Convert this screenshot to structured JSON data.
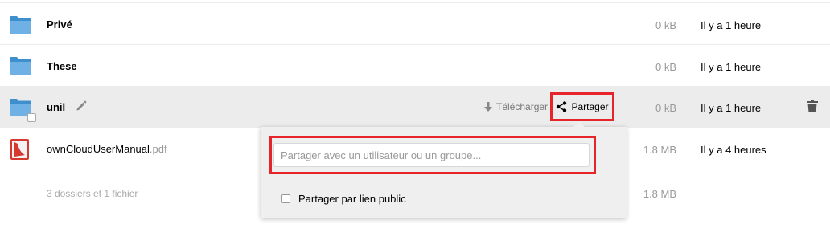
{
  "files": [
    {
      "name": "Privé",
      "ext": "",
      "size": "0 kB",
      "modified": "Il y a 1 heure",
      "type": "folder"
    },
    {
      "name": "These",
      "ext": "",
      "size": "0 kB",
      "modified": "Il y a 1 heure",
      "type": "folder"
    },
    {
      "name": "unil",
      "ext": "",
      "size": "0 kB",
      "modified": "Il y a 1 heure",
      "type": "folder"
    },
    {
      "name": "ownCloudUserManual",
      "ext": ".pdf",
      "size": "1.8 MB",
      "modified": "Il y a 4 heures",
      "type": "pdf"
    }
  ],
  "actions": {
    "download_label": "Télécharger",
    "share_label": "Partager"
  },
  "share_dropdown": {
    "input_placeholder": "Partager avec un utilisateur ou un groupe...",
    "public_link_label": "Partager par lien public",
    "public_link_checked": false
  },
  "summary": {
    "text": "3 dossiers et 1 fichier",
    "total_size": "1.8 MB"
  },
  "colors": {
    "folder_blue": "#4a9ad6",
    "highlight_red": "#e8242b",
    "selected_row": "#ececec",
    "pdf_red": "#d63a2f"
  },
  "icons": [
    "folder-icon",
    "pdf-icon",
    "pencil-icon",
    "download-icon",
    "share-icon",
    "trash-icon",
    "checkbox"
  ]
}
